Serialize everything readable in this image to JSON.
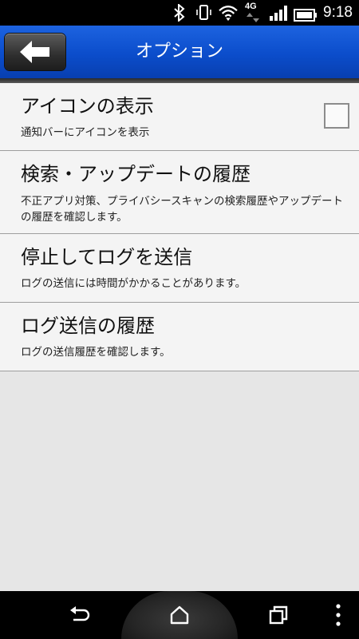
{
  "status_bar": {
    "time": "9:18",
    "network": "4G",
    "icons": [
      "bluetooth-icon",
      "phone-vibrate-icon",
      "wifi-icon",
      "network-4g-icon",
      "signal-icon",
      "battery-icon"
    ]
  },
  "app_bar": {
    "title": "オプション",
    "back_icon": "back-arrow-icon",
    "color": "#0b4dcb"
  },
  "options": [
    {
      "title": "アイコンの表示",
      "subtitle": "通知バーにアイコンを表示",
      "has_checkbox": true,
      "checked": false
    },
    {
      "title": "検索・アップデートの履歴",
      "subtitle": "不正アプリ対策、プライバシースキャンの検索履歴やアップデートの履歴を確認します。"
    },
    {
      "title": "停止してログを送信",
      "subtitle": "ログの送信には時間がかかることがあります。"
    },
    {
      "title": "ログ送信の履歴",
      "subtitle": "ログの送信履歴を確認します。"
    }
  ],
  "nav_bar": {
    "icons": [
      "back-nav-icon",
      "home-nav-icon",
      "recent-apps-icon",
      "menu-dots-icon"
    ]
  }
}
